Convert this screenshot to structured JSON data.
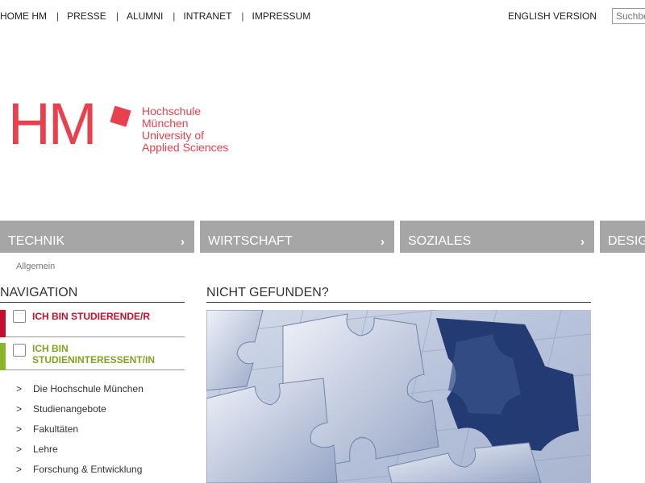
{
  "top_nav": {
    "items": [
      "HOME HM",
      "PRESSE",
      "ALUMNI",
      "INTRANET",
      "IMPRESSUM"
    ],
    "separator": "|",
    "english": "ENGLISH VERSION",
    "search_placeholder": "Suchbegriff"
  },
  "logo": {
    "mark": "HM",
    "lines": [
      "Hochschule",
      "München",
      "University of",
      "Applied Sciences"
    ],
    "color": "#e8414d"
  },
  "faculties": [
    "TECHNIK",
    "WIRTSCHAFT",
    "SOZIALES",
    "DESIGN"
  ],
  "faculty_arrow": "›",
  "breadcrumb": "Allgemein",
  "sidebar": {
    "heading": "NAVIGATION",
    "boxes": [
      {
        "label": "ICH BIN STUDIERENDE/R",
        "color": "#c4102e"
      },
      {
        "label_lines": [
          "ICH BIN",
          "STUDIENINTERESSENT/IN"
        ],
        "color": "#8ab52a"
      }
    ],
    "bullet": ">",
    "links": [
      "Die Hochschule München",
      "Studienangebote",
      "Fakultäten",
      "Lehre",
      "Forschung & Entwicklung"
    ]
  },
  "main": {
    "heading": "NICHT GEFUNDEN?"
  }
}
